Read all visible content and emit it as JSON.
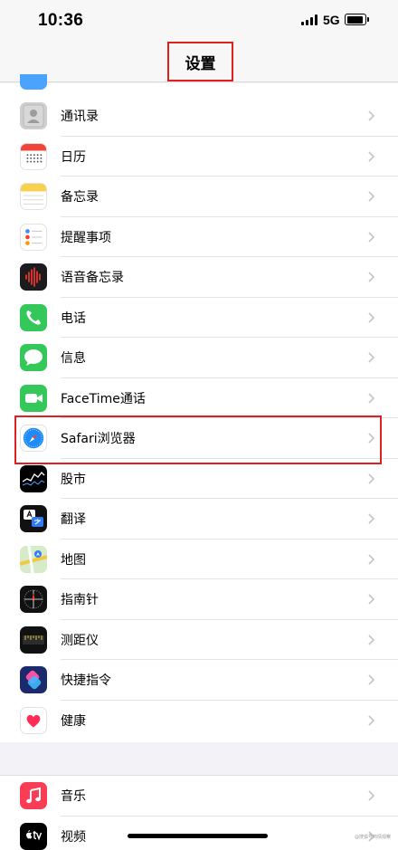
{
  "status_bar": {
    "time": "10:36",
    "network": "5G"
  },
  "nav": {
    "title": "设置"
  },
  "group_1": [
    {
      "label": "通讯录",
      "icon": "contacts-icon"
    },
    {
      "label": "日历",
      "icon": "calendar-icon"
    },
    {
      "label": "备忘录",
      "icon": "notes-icon"
    },
    {
      "label": "提醒事项",
      "icon": "reminders-icon"
    },
    {
      "label": "语音备忘录",
      "icon": "voice-memos-icon"
    },
    {
      "label": "电话",
      "icon": "phone-icon"
    },
    {
      "label": "信息",
      "icon": "messages-icon"
    },
    {
      "label": "FaceTime通话",
      "icon": "facetime-icon"
    },
    {
      "label": "Safari浏览器",
      "icon": "safari-icon"
    },
    {
      "label": "股市",
      "icon": "stocks-icon"
    },
    {
      "label": "翻译",
      "icon": "translate-icon"
    },
    {
      "label": "地图",
      "icon": "maps-icon"
    },
    {
      "label": "指南针",
      "icon": "compass-icon"
    },
    {
      "label": "测距仪",
      "icon": "measure-icon"
    },
    {
      "label": "快捷指令",
      "icon": "shortcuts-icon"
    },
    {
      "label": "健康",
      "icon": "health-icon"
    }
  ],
  "group_2": [
    {
      "label": "音乐",
      "icon": "music-icon"
    },
    {
      "label": "视频",
      "icon": "tv-icon"
    }
  ],
  "watermark": "@搜狐号商情观察",
  "colors": {
    "highlight": "#e02020",
    "chevron": "#c4c4c7",
    "separator": "#e3e3e6",
    "background": "#f2f2f7"
  }
}
